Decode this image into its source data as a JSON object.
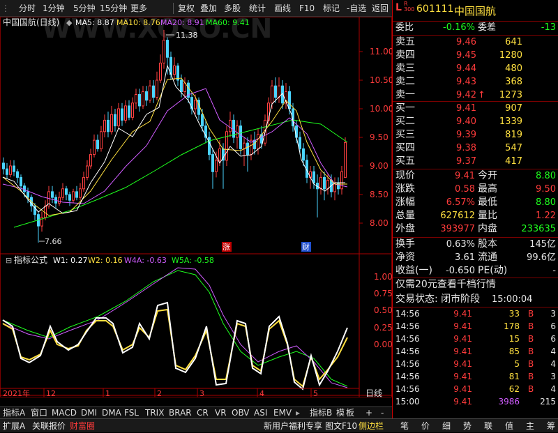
{
  "toolbar": {
    "left_items": [
      "分时",
      "1分钟",
      "5分钟",
      "15分钟",
      "更多"
    ],
    "right_items": [
      "复权",
      "叠加",
      "多股",
      "统计",
      "画线",
      "F10",
      "标记",
      "-自选",
      "返回"
    ],
    "menu_marker": "L",
    "menu_sub": "R 300"
  },
  "stock": {
    "code": "601111",
    "name": "中国国航"
  },
  "main_chart": {
    "title": "中国国航(日线)",
    "ma": [
      {
        "label": "MA5: 8.87",
        "color": "#ffffff"
      },
      {
        "label": "MA10: 8.76",
        "color": "#ffe040"
      },
      {
        "label": "MA20: 8.91",
        "color": "#d05cff"
      },
      {
        "label": "MA60: 9.41",
        "color": "#1eff1e"
      }
    ],
    "price_axis": [
      "11.00",
      "10.50",
      "10.00",
      "9.50",
      "9.00",
      "8.50",
      "8.00"
    ],
    "high_label": "11.38",
    "low_label": "7.66",
    "event_up": "涨",
    "event_fin": "财",
    "watermark": "WWW.XOSO.CN"
  },
  "indicator": {
    "title": "指标公式",
    "lines": [
      {
        "label": "W1: 0.27",
        "color": "#ffffff"
      },
      {
        "label": "W2: 0.16",
        "color": "#ffe040"
      },
      {
        "label": "W4A: -0.63",
        "color": "#d05cff"
      },
      {
        "label": "W5A: -0.58",
        "color": "#1eff1e"
      }
    ],
    "axis": [
      "1.00",
      "0.75",
      "0.50",
      "0.25",
      "0.00"
    ]
  },
  "date_axis": {
    "year": "2021年",
    "months": [
      "12",
      "1",
      "2",
      "3",
      "4",
      "5"
    ],
    "period": "日线"
  },
  "bottom_tabs": [
    "指标A",
    "窗口",
    "MACD",
    "DMI",
    "DMA",
    "FSL",
    "TRIX",
    "BRAR",
    "CR",
    "VR",
    "OBV",
    "ASI",
    "EMV"
  ],
  "bottom_tabs_right": [
    "指标B",
    "模",
    "板",
    "+",
    "-"
  ],
  "footer": {
    "left": [
      "扩展A",
      "关联报价",
      "财富圈"
    ],
    "promo": "新用户福利专享",
    "mid": [
      "图文F10",
      "侧边栏"
    ],
    "right": [
      "笔",
      "价",
      "细",
      "势",
      "联",
      "值",
      "主",
      "筹"
    ]
  },
  "quote": {
    "webi_label": "委比",
    "webi": "-0.16%",
    "wecha_label": "委差",
    "wecha": "-13",
    "asks": [
      {
        "label": "卖五",
        "price": "9.46",
        "vol": "641"
      },
      {
        "label": "卖四",
        "price": "9.45",
        "vol": "1280"
      },
      {
        "label": "卖三",
        "price": "9.44",
        "vol": "480"
      },
      {
        "label": "卖二",
        "price": "9.43",
        "vol": "368"
      },
      {
        "label": "卖一",
        "price": "9.42",
        "vol": "1273",
        "arrow": "↑"
      }
    ],
    "bids": [
      {
        "label": "买一",
        "price": "9.41",
        "vol": "907"
      },
      {
        "label": "买二",
        "price": "9.40",
        "vol": "1339"
      },
      {
        "label": "买三",
        "price": "9.39",
        "vol": "819"
      },
      {
        "label": "买四",
        "price": "9.38",
        "vol": "547"
      },
      {
        "label": "买五",
        "price": "9.37",
        "vol": "417"
      }
    ],
    "stats": [
      {
        "l1": "现价",
        "v1": "9.41",
        "l2": "今开",
        "v2": "8.80"
      },
      {
        "l1": "涨跌",
        "v1": "0.58",
        "l2": "最高",
        "v2": "9.50"
      },
      {
        "l1": "涨幅",
        "v1": "6.57%",
        "l2": "最低",
        "v2": "8.80"
      },
      {
        "l1": "总量",
        "v1": "627612",
        "l2": "量比",
        "v2": "1.22"
      },
      {
        "l1": "外盘",
        "v1": "393977",
        "l2": "内盘",
        "v2": "233635"
      }
    ],
    "stats2": [
      {
        "l1": "换手",
        "v1": "0.63%",
        "l2": "股本",
        "v2": "145亿"
      },
      {
        "l1": "净资",
        "v1": "3.61",
        "l2": "流通",
        "v2": "99.6亿"
      },
      {
        "l1": "收益(一)",
        "v1": "-0.650",
        "l2": "PE(动)",
        "v2": "-"
      }
    ],
    "promo": "仅需20元查看千档行情",
    "status_label": "交易状态: 闭市阶段",
    "status_time": "15:00:04",
    "ticks": [
      {
        "t": "14:56",
        "p": "9.41",
        "v": "33",
        "d": "B",
        "n": "3"
      },
      {
        "t": "14:56",
        "p": "9.41",
        "v": "178",
        "d": "B",
        "n": "6"
      },
      {
        "t": "14:56",
        "p": "9.41",
        "v": "15",
        "d": "B",
        "n": "6"
      },
      {
        "t": "14:56",
        "p": "9.41",
        "v": "85",
        "d": "B",
        "n": "4"
      },
      {
        "t": "14:56",
        "p": "9.41",
        "v": "5",
        "d": "B",
        "n": "4"
      },
      {
        "t": "14:56",
        "p": "9.41",
        "v": "81",
        "d": "B",
        "n": "3"
      },
      {
        "t": "14:56",
        "p": "9.41",
        "v": "62",
        "d": "B",
        "n": "4"
      },
      {
        "t": "15:00",
        "p": "9.41",
        "v": "3986",
        "d": "",
        "n": "215"
      }
    ]
  }
}
